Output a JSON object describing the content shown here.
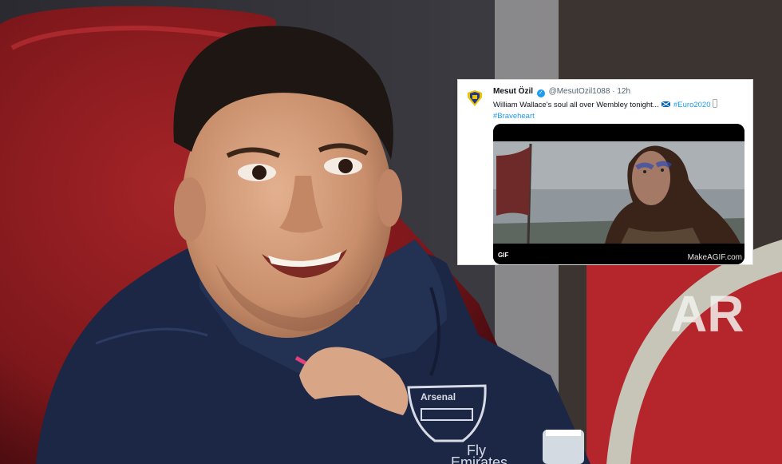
{
  "tweet": {
    "display_name": "Mesut Özil",
    "handle": "@MesutOzil1088",
    "separator": "·",
    "time": "12h",
    "text": "William Wallace's soul all over Wembley tonight...",
    "hashtags": [
      "#Euro2020",
      "#Braveheart"
    ],
    "media_badge": "GIF",
    "media_watermark": "MakeAGIF.com"
  },
  "scene": {
    "kit_sponsor_lines": [
      "Fly",
      "Emirates"
    ],
    "crest_text": "Arsenal",
    "background_board_text": "AR"
  },
  "icons": {
    "verified": "verified-badge-icon",
    "flag": "scotland-flag-icon",
    "bottle": "bottle-emoji-icon"
  },
  "colors": {
    "twitter_blue": "#1d9bf0",
    "seat_red": "#8c1c1f",
    "jacket_navy": "#1c2745",
    "board_red": "#b5262c"
  }
}
